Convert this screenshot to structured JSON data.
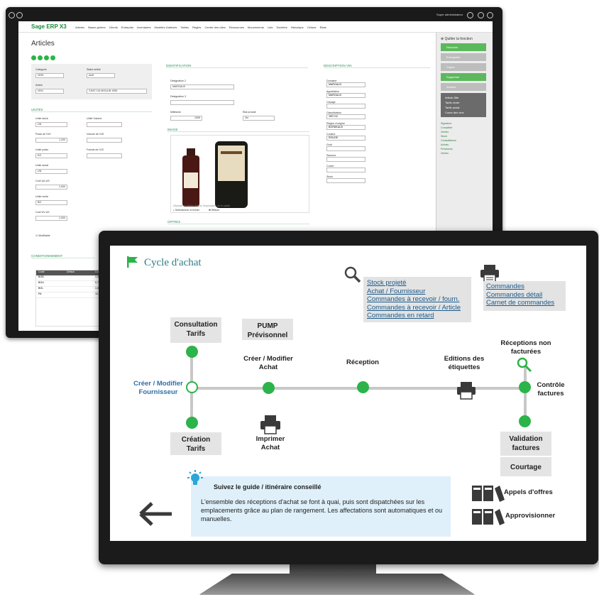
{
  "back_app": {
    "brand": "Sage ERP X3",
    "nav": [
      "Articles",
      "Bases gérées",
      "Clients",
      "Entrepôts",
      "Inventaires",
      "Modèles d'articles",
      "Tables",
      "Règles",
      "Centre des rôles",
      "Ressources",
      "Mouvements",
      "Lots",
      "Sociétés",
      "Historique",
      "Clôture",
      "États"
    ],
    "user": "Super administrateur",
    "page_title": "Articles",
    "right_panel": {
      "close_label": "Quitter la fonction",
      "buttons": [
        "Nouveau",
        "Enregistrer",
        "Copier",
        "Supprimer",
        "Annuler"
      ],
      "dark_items": [
        "Article-Site",
        "Tarifs vente",
        "Tarifs achat",
        "Cours des vins"
      ],
      "links": [
        "Signature",
        "Compléter",
        "Ventes",
        "Stock",
        "Consultations",
        "Achats",
        "Prévisions",
        "Ventes"
      ]
    },
    "sections": {
      "units": "UNITÉS",
      "identification": "IDENTIFICATION",
      "description": "DESCRIPTION VIN",
      "image": "IMAGE",
      "offers": "OFFRES",
      "packaging": "CONDITIONNEMENT"
    },
    "fields": {
      "category_label": "Catégorie",
      "category": "VINS",
      "status_label": "Statut article",
      "status": "Actif",
      "article_label": "Article",
      "article": "VIN1",
      "article_desc": "CHAT. DU MOULIN 1995",
      "stock_unit_label": "Unité stock",
      "stock_unit": "UN",
      "weight_label": "Poids de l'US",
      "weight": "1,200",
      "weight_unit_label": "Unité poids",
      "weight_unit": "KG",
      "buy_unit_label": "Unité achat",
      "buy_unit": "UN",
      "coef_label": "Coef UA-US",
      "coef": "1,000",
      "sale_unit_label": "Unité vente",
      "sale_unit": "BO",
      "coef2_label": "Coef UV-US",
      "coef2": "1,000",
      "volume_label": "Unité Volume",
      "volume_us_label": "Volume de l'US",
      "format_label": "Format de l'US",
      "managed_label": "Modifiable",
      "desig2_label": "Désignation 2",
      "desig2": "MARGAUX",
      "desig3_label": "Désignation 3",
      "vintage_label": "Millésime",
      "vintage": "1995",
      "product_state_label": "État produit",
      "product_state": "Vin",
      "domain_label": "Domaine",
      "domain": "MARGAUX",
      "appellation_label": "Appellation",
      "appellation": "MARGAUX",
      "cepage_label": "Cépage",
      "classification_label": "Classification",
      "classification": "1ER GC",
      "origin_label": "Région d'origine",
      "origin": "BORDEAUX",
      "color_label": "Couleur",
      "color": "ROUGE",
      "gout_label": "Goût",
      "saveur_label": "Saveurs",
      "cuvee_label": "Cuvée",
      "stock_label": "Stock",
      "image_caption": "Déposer un fichier depuis l'explorateur ou le cadre",
      "image_select": "Sélectionner le fichier",
      "image_delete": "Effacer"
    },
    "table_headers": [
      "Code",
      "Défaut",
      "Coef"
    ],
    "table_rows": [
      [
        "BOB",
        "",
        "1,000"
      ],
      [
        "BOU",
        "",
        "0,750"
      ],
      [
        "BOL",
        "",
        "1,500"
      ],
      [
        "PA",
        "",
        "12,000"
      ]
    ]
  },
  "front": {
    "title": "Cycle d'achat",
    "links_left": [
      "Stock projeté",
      "Achat / Fournisseur",
      "Commandes à recevoir / fourn.",
      "Commandes à recevoir / Article",
      "Commandes en retard"
    ],
    "links_right": [
      "Commandes",
      "Commandes détail",
      "Carnet de commandes"
    ],
    "boxes": {
      "consultation": "Consultation\nTarifs",
      "pump": "PUMP\nPrévisonnel",
      "creation": "Création\nTarifs",
      "validation": "Validation\nfactures",
      "courtage": "Courtage"
    },
    "labels": {
      "creer_fournisseur": "Créer / Modifier\nFournisseur",
      "creer_achat": "Créer / Modifier\nAchat",
      "reception": "Réception",
      "editions": "Editions des\nétiquettes",
      "receptions_non": "Réceptions non\nfacturées",
      "controle": "Contrôle\nfactures",
      "imprimer": "Imprimer\nAchat"
    },
    "guide": {
      "title": "Suivez le guide / itinéraire conseillé",
      "text": "L'ensemble des réceptions d'achat se font à quai, puis sont dispatchées sur les emplacements grâce au plan de rangement. Les affectations sont automatiques et ou manuelles."
    },
    "side_items": {
      "appels": "Appels d'offres",
      "approvisionner": "Approvisionner"
    }
  },
  "colors": {
    "accent_green": "#2cb34a",
    "link_blue": "#1a5a8c",
    "title_teal": "#2f7d88",
    "guide_bg": "#dff0fa"
  }
}
